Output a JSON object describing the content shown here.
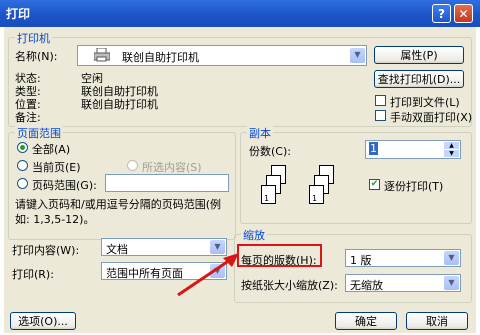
{
  "window": {
    "title": "打印",
    "help_label": "?",
    "close_label": "✕"
  },
  "printer": {
    "group_label": "打印机",
    "name_label": "名称(N):",
    "name_value": "联创自助打印机",
    "status_label": "状态:",
    "status_value": "空闲",
    "type_label": "类型:",
    "type_value": "联创自助打印机",
    "location_label": "位置:",
    "location_value": "联创自助打印机",
    "comment_label": "备注:",
    "properties_button": "属性(P)",
    "find_button": "查找打印机(D)...",
    "print_to_file_label": "打印到文件(L)",
    "manual_duplex_label": "手动双面打印(X)"
  },
  "page_range": {
    "group_label": "页面范围",
    "all_label": "全部(A)",
    "current_label": "当前页(E)",
    "selection_label": "所选内容(S)",
    "pages_label": "页码范围(G):",
    "hint": "请键入页码和/或用逗号分隔的页码范围(例如: 1,3,5-12)。"
  },
  "copies": {
    "group_label": "副本",
    "count_label": "份数(C):",
    "count_value": "1",
    "collate_label": "逐份打印(T)",
    "page_numbers": [
      "3",
      "2",
      "1",
      "3",
      "2",
      "1"
    ]
  },
  "print_what": {
    "label": "打印内容(W):",
    "value": "文档"
  },
  "print_range": {
    "label": "打印(R):",
    "value": "范围中所有页面"
  },
  "zoom": {
    "group_label": "缩放",
    "pages_per_sheet_label": "每页的版数(H):",
    "pages_per_sheet_value": "1 版",
    "scale_label": "按纸张大小缩放(Z):",
    "scale_value": "无缩放"
  },
  "footer": {
    "options_button": "选项(O)...",
    "ok_button": "确定",
    "cancel_button": "取消"
  },
  "colors": {
    "annotation_red": "#d91515",
    "titlebar_blue": "#1c54c9"
  }
}
